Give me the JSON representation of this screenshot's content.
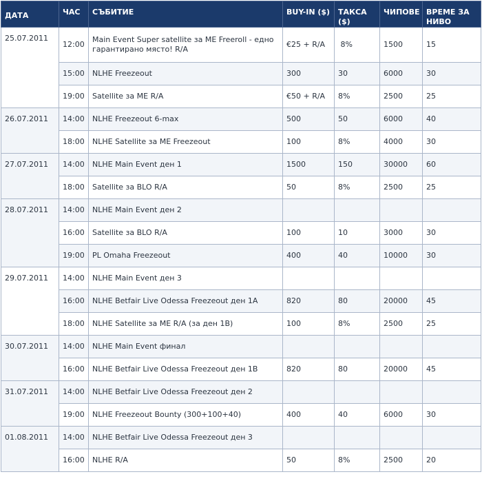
{
  "headers": {
    "date": "ДАТА",
    "time": "ЧАС",
    "event": "СЪБИТИЕ",
    "buyin": "BUY-IN ($)",
    "fee": "ТАКСА ($)",
    "chips": "ЧИПОВЕ",
    "level": "ВРЕМЕ ЗА НИВО"
  },
  "days": [
    {
      "date": "25.07.2011",
      "rows": [
        {
          "time": "12:00",
          "event": "Main Event Super satellite за ME Freeroll - едно гарантирано място! R/A",
          "buyin": "€25 + R/A",
          "fee": " 8%",
          "chips": "1500",
          "level": "15"
        },
        {
          "time": "15:00",
          "event": "NLHE Freezeout",
          "buyin": "300",
          "fee": "30",
          "chips": "6000",
          "level": "30"
        },
        {
          "time": "19:00",
          "event": "Satellite за ME R/A",
          "buyin": "€50 + R/A",
          "fee": "8%",
          "chips": "2500",
          "level": "25"
        }
      ]
    },
    {
      "date": "26.07.2011",
      "rows": [
        {
          "time": "14:00",
          "event": "NLHE Freezeout 6-max",
          "buyin": "500",
          "fee": "50",
          "chips": "6000",
          "level": "40"
        },
        {
          "time": "18:00",
          "event": "NLHE Satellite за ME Freezeout",
          "buyin": "100",
          "fee": "8%",
          "chips": "4000",
          "level": "30"
        }
      ]
    },
    {
      "date": "27.07.2011",
      "rows": [
        {
          "time": "14:00",
          "event": "NLHE Main Event ден 1",
          "buyin": "1500",
          "fee": "150",
          "chips": "30000",
          "level": "60"
        },
        {
          "time": "18:00",
          "event": "Satellite за BLO R/A",
          "buyin": "50",
          "fee": "8%",
          "chips": "2500",
          "level": "25"
        }
      ]
    },
    {
      "date": "28.07.2011",
      "rows": [
        {
          "time": "14:00",
          "event": "NLHE Main Event ден 2",
          "buyin": "",
          "fee": "",
          "chips": "",
          "level": ""
        },
        {
          "time": "16:00",
          "event": "Satellite за BLO R/A",
          "buyin": "100",
          "fee": "10",
          "chips": "3000",
          "level": "30"
        },
        {
          "time": "19:00",
          "event": "PL Omaha Freezeout",
          "buyin": "400",
          "fee": "40",
          "chips": "10000",
          "level": "30"
        }
      ]
    },
    {
      "date": "29.07.2011",
      "rows": [
        {
          "time": "14:00",
          "event": "NLHE Main Event ден 3",
          "buyin": "",
          "fee": "",
          "chips": "",
          "level": ""
        },
        {
          "time": "16:00",
          "event": "NLHE Betfair Live Odessa  Freezeout ден 1A",
          "buyin": "820",
          "fee": "80",
          "chips": "20000",
          "level": "45"
        },
        {
          "time": "18:00",
          "event": "NLHE Satellite за ME  R/A (за ден 1B)",
          "buyin": "100",
          "fee": "8%",
          "chips": "2500",
          "level": "25"
        }
      ]
    },
    {
      "date": "30.07.2011",
      "rows": [
        {
          "time": "14:00",
          "event": "NLHE Main Event финал",
          "buyin": "",
          "fee": "",
          "chips": "",
          "level": ""
        },
        {
          "time": "16:00",
          "event": "NLHE Betfair Live Odessa  Freezeout ден 1B",
          "buyin": "820",
          "fee": "80",
          "chips": "20000",
          "level": "45"
        }
      ]
    },
    {
      "date": "31.07.2011",
      "rows": [
        {
          "time": "14:00",
          "event": "NLHE Betfair Live Odessa  Freezeout ден 2",
          "buyin": "",
          "fee": "",
          "chips": "",
          "level": ""
        },
        {
          "time": "19:00",
          "event": "NLHE Freezeout Bounty (300+100+40)",
          "buyin": "400",
          "fee": "40",
          "chips": "6000",
          "level": "30"
        }
      ]
    },
    {
      "date": "01.08.2011",
      "rows": [
        {
          "time": "14:00",
          "event": "NLHE Betfair Live Odessa  Freezeout ден 3",
          "buyin": "",
          "fee": "",
          "chips": "",
          "level": ""
        },
        {
          "time": "16:00",
          "event": "NLHE R/A",
          "buyin": "50",
          "fee": "8%",
          "chips": "2500",
          "level": "20"
        }
      ]
    }
  ]
}
